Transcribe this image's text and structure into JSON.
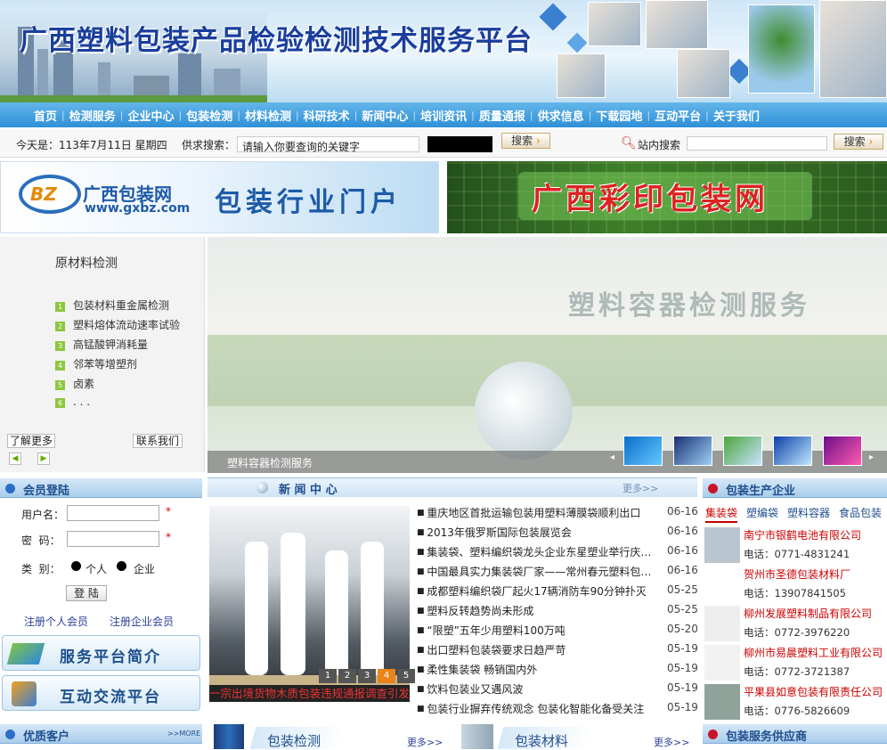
{
  "header": {
    "title": "广西塑料包装产品检验检测技术服务平台"
  },
  "nav": [
    "首页",
    "检测服务",
    "企业中心",
    "包装检测",
    "材料检测",
    "科研技术",
    "新闻中心",
    "培训资讯",
    "质量通报",
    "供求信息",
    "下载园地",
    "互动平台",
    "关于我们"
  ],
  "toolbar": {
    "date": "今天是：113年7月11日  星期四",
    "supply_label": "供求搜索：",
    "supply_placeholder": "请输入你要查询的关键字",
    "search_btn": "搜索",
    "site_label": "站内搜索",
    "site_btn": "搜索"
  },
  "banners": {
    "b1_brand": "广西包装网",
    "b1_url": "www.gxbz.com",
    "b1_logo": "BZ",
    "b1_slogan": "包装行业门户",
    "b2_text": "广西彩印包装网"
  },
  "subpanel": {
    "title": "原材料检测",
    "items": [
      {
        "n": "1",
        "t": "包装材料重金属检测"
      },
      {
        "n": "2",
        "t": "塑料熔体流动速率试验"
      },
      {
        "n": "3",
        "t": "高锰酸钾消耗量"
      },
      {
        "n": "4",
        "t": "邻苯等增塑剂"
      },
      {
        "n": "5",
        "t": "卤素"
      },
      {
        "n": "6",
        "t": ". . ."
      }
    ],
    "more": "了解更多",
    "contact": "联系我们"
  },
  "slideshow": {
    "overlay_title": "塑料容器检测服务",
    "caption": "塑料容器检测服务"
  },
  "login": {
    "title": "会员登陆",
    "user_label": "用户名：",
    "pass_label": "密  码：",
    "type_label": "类  别：",
    "type_personal": "个人",
    "type_company": "企业",
    "submit": "登 陆",
    "reg_personal": "注册个人会员",
    "reg_company": "注册企业会员",
    "star": "*"
  },
  "sidebuttons": {
    "intro": "服务平台简介",
    "interact": "互动交流平台"
  },
  "quality": {
    "title": "优质客户",
    "more": ">>MORE"
  },
  "news": {
    "title": "新 闻 中 心",
    "more": "更多>>",
    "photo_caption": "一宗出境货物木质包装违规通报调查引发的",
    "pages": [
      "1",
      "2",
      "3",
      "4",
      "5"
    ],
    "items": [
      {
        "t": "重庆地区首批运输包装用塑料薄膜袋顺利出口",
        "d": "06-16"
      },
      {
        "t": "2013年俄罗斯国际包装展览会",
        "d": "06-16"
      },
      {
        "t": "集装袋、塑料编织袋龙头企业东星塑业举行庆典...",
        "d": "06-16"
      },
      {
        "t": "中国最具实力集装袋厂家——常州春元塑料包装...",
        "d": "06-16"
      },
      {
        "t": "成都塑料编织袋厂起火17辆消防车90分钟扑灭",
        "d": "05-25"
      },
      {
        "t": "塑料反转趋势尚未形成",
        "d": "05-25"
      },
      {
        "t": "“限塑”五年少用塑料100万吨",
        "d": "05-20"
      },
      {
        "t": "出口塑料包装袋要求日趋严苛",
        "d": "05-19"
      },
      {
        "t": "柔性集装袋 畅销国内外",
        "d": "05-19"
      },
      {
        "t": "饮料包装业又遇风波",
        "d": "05-19"
      },
      {
        "t": "包装行业摒弃传统观念 包装化智能化备受关注",
        "d": "05-19"
      }
    ]
  },
  "bottom": {
    "pkg_test": "包装检测",
    "pkg_mat": "包装材料",
    "more": "更多>>"
  },
  "companies": {
    "title": "包装生产企业",
    "tabs": [
      "集装袋",
      "塑编袋",
      "塑料容器",
      "食品包装"
    ],
    "items": [
      {
        "name": "南宁市银鹤电池有限公司",
        "phone": "电话：0771-4831241"
      },
      {
        "name": "贺州市圣德包装材料厂",
        "phone": "电话：13907841505"
      },
      {
        "name": "柳州发展塑料制品有限公司",
        "phone": "电话：0772-3976220"
      },
      {
        "name": "柳州市易晨塑料工业有限公司",
        "phone": "电话：0772-3721387"
      },
      {
        "name": "平果县如意包装有限责任公司",
        "phone": "电话：0776-5826609"
      }
    ]
  },
  "suppliers": {
    "title": "包装服务供应商"
  }
}
